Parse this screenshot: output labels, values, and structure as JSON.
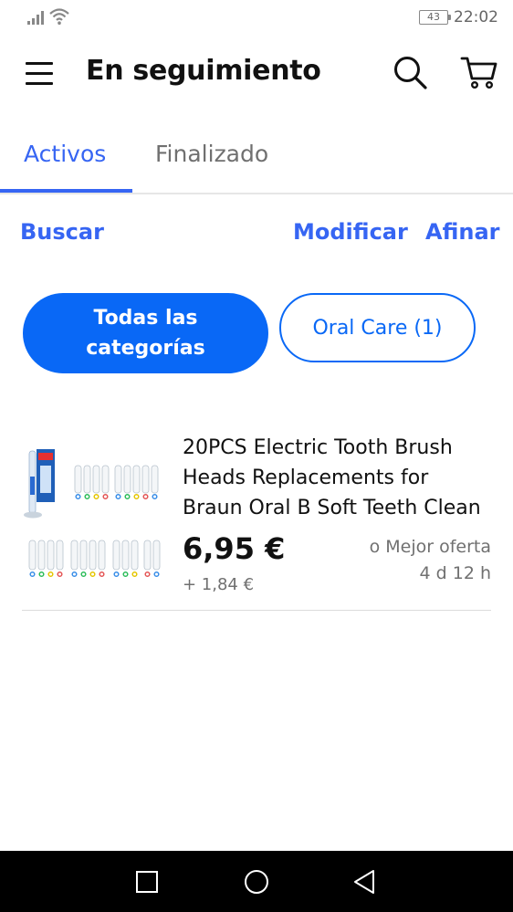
{
  "status_bar": {
    "battery": "43",
    "time": "22:02",
    "icons": [
      "signal-icon",
      "wifi-icon",
      "battery-icon"
    ]
  },
  "header": {
    "title": "En seguimiento",
    "icons": [
      "menu-icon",
      "search-icon",
      "cart-icon"
    ]
  },
  "tabs": [
    {
      "label": "Activos",
      "active": true
    },
    {
      "label": "Finalizado",
      "active": false
    }
  ],
  "actions": {
    "search": "Buscar",
    "edit": "Modificar",
    "refine": "Afinar"
  },
  "categories": {
    "all": "Todas las categorías",
    "oral_care": "Oral Care (1)"
  },
  "listing": {
    "title": "20PCS Electric Tooth Brush Heads Replacements for Braun Oral B Soft Teeth Clean",
    "price": "6,95 €",
    "shipping": "+ 1,84 €",
    "buying_option": "o Mejor oferta",
    "time_left": "4 d 12 h"
  },
  "colors": {
    "accent": "#3665f3",
    "chip_fill": "#0968f6",
    "text_primary": "#111111",
    "text_secondary": "#707070"
  },
  "navbar": {
    "icons": [
      "recent-apps-icon",
      "home-icon",
      "back-icon"
    ]
  }
}
